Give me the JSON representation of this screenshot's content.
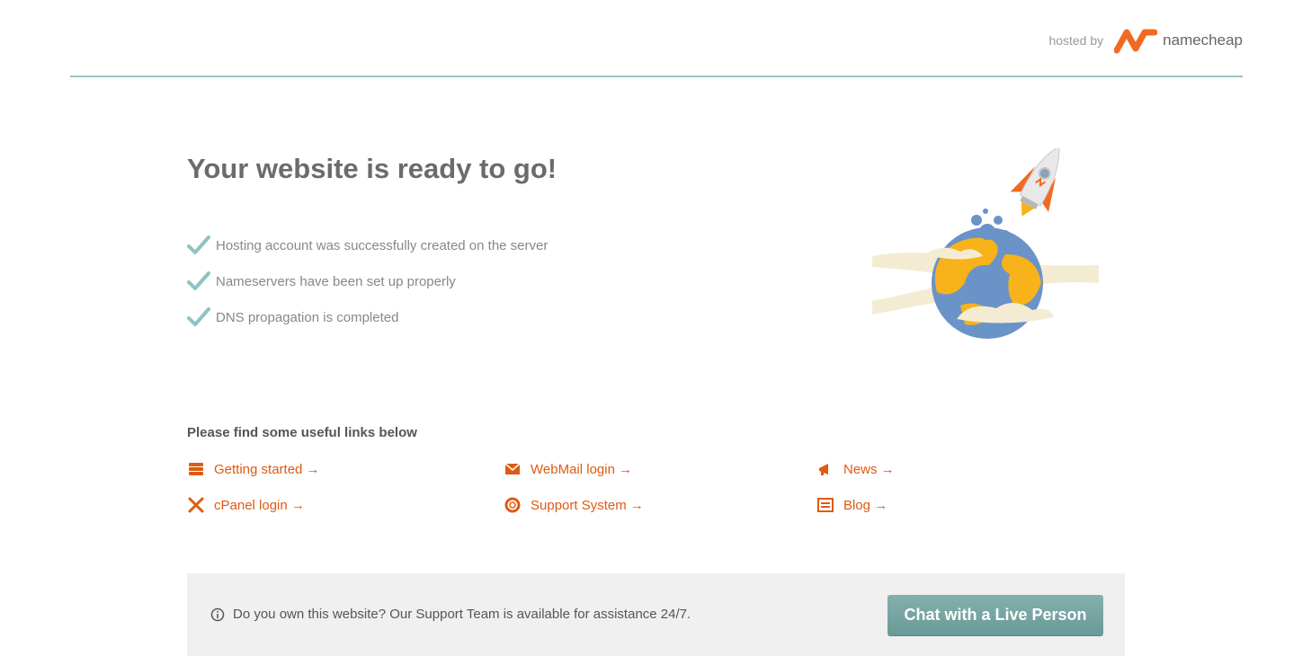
{
  "header": {
    "hosted_by": "hosted by",
    "brand": "namecheap"
  },
  "main": {
    "title": "Your website is ready to go!",
    "checklist": [
      "Hosting account was successfully created on the server",
      "Nameservers have been set up properly",
      "DNS propagation is completed"
    ]
  },
  "links": {
    "title": "Please find some useful links below",
    "items": [
      {
        "label": "Getting started →",
        "icon": "server-icon"
      },
      {
        "label": "WebMail login →",
        "icon": "envelope-icon"
      },
      {
        "label": "News →",
        "icon": "bullhorn-icon"
      },
      {
        "label": "cPanel login →",
        "icon": "tools-icon"
      },
      {
        "label": "Support System →",
        "icon": "lifebuoy-icon"
      },
      {
        "label": "Blog →",
        "icon": "blog-icon"
      }
    ]
  },
  "support": {
    "text": "Do you own this website? Our Support Team is available for assistance 24/7.",
    "chat_button": "Chat with a Live Person"
  },
  "colors": {
    "accent": "#e05a12",
    "divider": "#9cc5c3",
    "check": "#8ec3c1",
    "button": "#76a5a2"
  }
}
